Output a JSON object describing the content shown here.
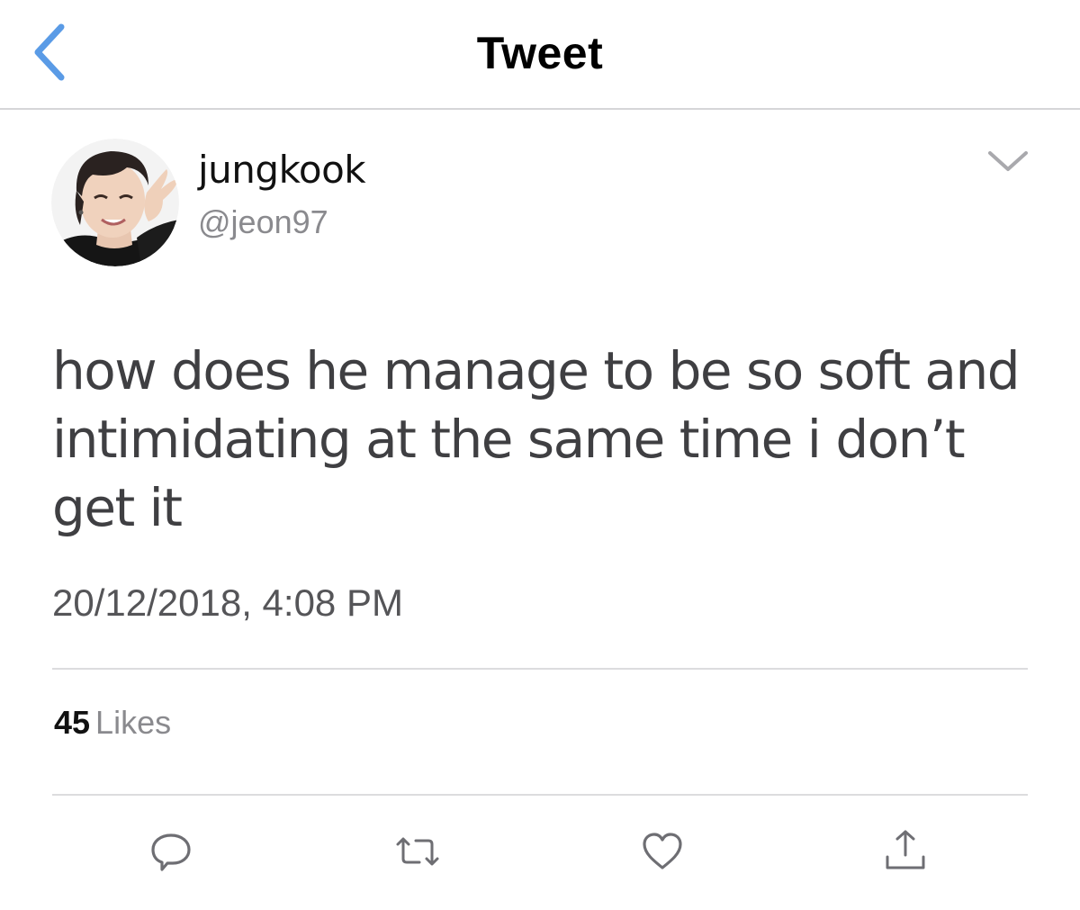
{
  "nav": {
    "title": "Tweet",
    "back_icon": "chevron-left-icon"
  },
  "author": {
    "display_name": "jungkook",
    "handle": "@jeon97",
    "avatar": "profile-photo"
  },
  "tweet": {
    "text": "how does he manage to be so soft and intimidating at the same time i don’t get it",
    "timestamp": "20/12/2018, 4:08 PM"
  },
  "stats": {
    "likes_count": "45",
    "likes_label": "Likes"
  },
  "actions": [
    {
      "name": "reply",
      "icon": "reply-icon"
    },
    {
      "name": "retweet",
      "icon": "retweet-icon"
    },
    {
      "name": "like",
      "icon": "heart-icon"
    },
    {
      "name": "share",
      "icon": "share-icon"
    }
  ],
  "colors": {
    "accent": "#5a9be6",
    "text_primary": "#111111",
    "text_secondary": "#8a8a8e",
    "icon_gray": "#6e6e73",
    "divider": "#dcdcde"
  }
}
